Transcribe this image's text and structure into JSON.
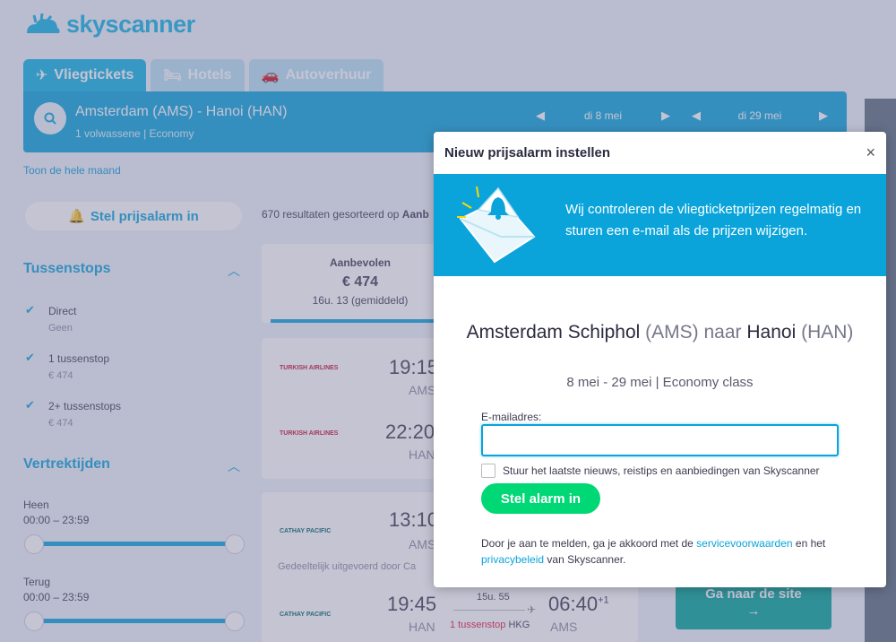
{
  "brand": {
    "name": "skyscanner"
  },
  "tabs": [
    {
      "label": "Vliegtickets",
      "icon": "plane-icon"
    },
    {
      "label": "Hotels",
      "icon": "bed-icon"
    },
    {
      "label": "Autoverhuur",
      "icon": "car-icon"
    }
  ],
  "search": {
    "route": "Amsterdam (AMS) - Hanoi (HAN)",
    "passengers": "1 volwassene",
    "cabin": "Economy",
    "depart_date": "di 8 mei",
    "return_date": "di 29 mei"
  },
  "sidebar": {
    "month_link": "Toon de hele maand",
    "alarm_button": "Stel prijsalarm in",
    "stops_title": "Tussenstops",
    "stops": [
      {
        "label": "Direct",
        "price": "Geen"
      },
      {
        "label": "1 tussenstop",
        "price": "€ 474"
      },
      {
        "label": "2+ tussenstops",
        "price": "€ 474"
      }
    ],
    "times_title": "Vertrektijden",
    "outbound_label": "Heen",
    "outbound_range": "00:00 – 23:59",
    "return_label": "Terug",
    "return_range": "00:00 – 23:59"
  },
  "results": {
    "count_text": "670 resultaten gesorteerd op",
    "sort_bold": "Aanb",
    "sort_card": {
      "label": "Aanbevolen",
      "price": "€ 474",
      "duration": "16u. 13 (gemiddeld)"
    },
    "flights": [
      {
        "airline": "TURKISH AIRLINES",
        "time1": "19:15",
        "code1": "AMS",
        "time2": "22:20",
        "code2": "HAN"
      },
      {
        "airline": "CATHAY PACIFIC",
        "time1": "13:10",
        "code1": "AMS",
        "operated": "Gedeeltelijk uitgevoerd door Ca",
        "time2": "19:45",
        "code2": "HAN",
        "duration": "15u. 55",
        "stops": "1 tussenstop",
        "via": "HKG",
        "arrive": "06:40",
        "arrive_sup": "+1",
        "arrive_code": "AMS"
      }
    ],
    "go_button": "Ga naar de site",
    "go_arrow": "→"
  },
  "modal": {
    "title": "Nieuw prijsalarm instellen",
    "close": "×",
    "banner_text": "Wij controleren de vliegticketprijzen regelmatig en sturen een e-mail als de prijzen wijzigen.",
    "from": "Amsterdam Schiphol",
    "from_code": "(AMS)",
    "connector": "naar",
    "to": "Hanoi",
    "to_code": "(HAN)",
    "dates": "8 mei - 29 mei | Economy class",
    "email_label": "E-mailadres:",
    "email_value": "",
    "newsletter_label": "Stuur het laatste nieuws, reistips en aanbiedingen van Skyscanner",
    "submit": "Stel alarm in",
    "legal_pre": "Door je aan te melden, ga je akkoord met de",
    "terms_link": "servicevoorwaarden",
    "legal_mid": "en het",
    "privacy_link": "privacybeleid",
    "legal_post": "van Skyscanner."
  },
  "colors": {
    "brand": "#0aa4db",
    "cta": "#00d775",
    "go": "#00a698"
  }
}
